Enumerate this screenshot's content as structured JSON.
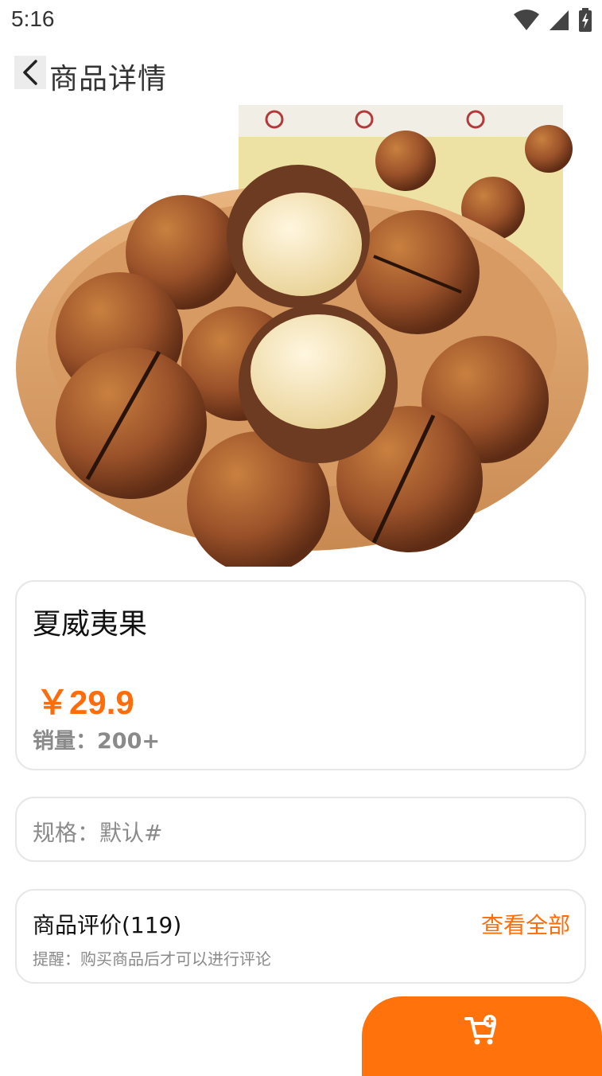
{
  "status_bar": {
    "time": "5:16",
    "icons": [
      "wifi-icon",
      "signal-icon",
      "battery-charging-icon"
    ]
  },
  "header": {
    "back_icon": "chevron-left-icon",
    "title": "商品详情"
  },
  "product": {
    "image_description_icon": "macadamia-nuts-photo",
    "name": "夏威夷果",
    "price": "￥29.9",
    "sales": "销量：200+"
  },
  "spec": {
    "text": "规格：默认#"
  },
  "reviews": {
    "title": "商品评价(119)",
    "view_all": "查看全部",
    "tip": "提醒：购买商品后才可以进行评论"
  },
  "cart": {
    "icon": "add-to-cart-icon"
  },
  "colors": {
    "accent": "#ff720c",
    "price": "#ff6d0a",
    "muted": "#8a8a8a",
    "border": "#e7e7e7"
  }
}
